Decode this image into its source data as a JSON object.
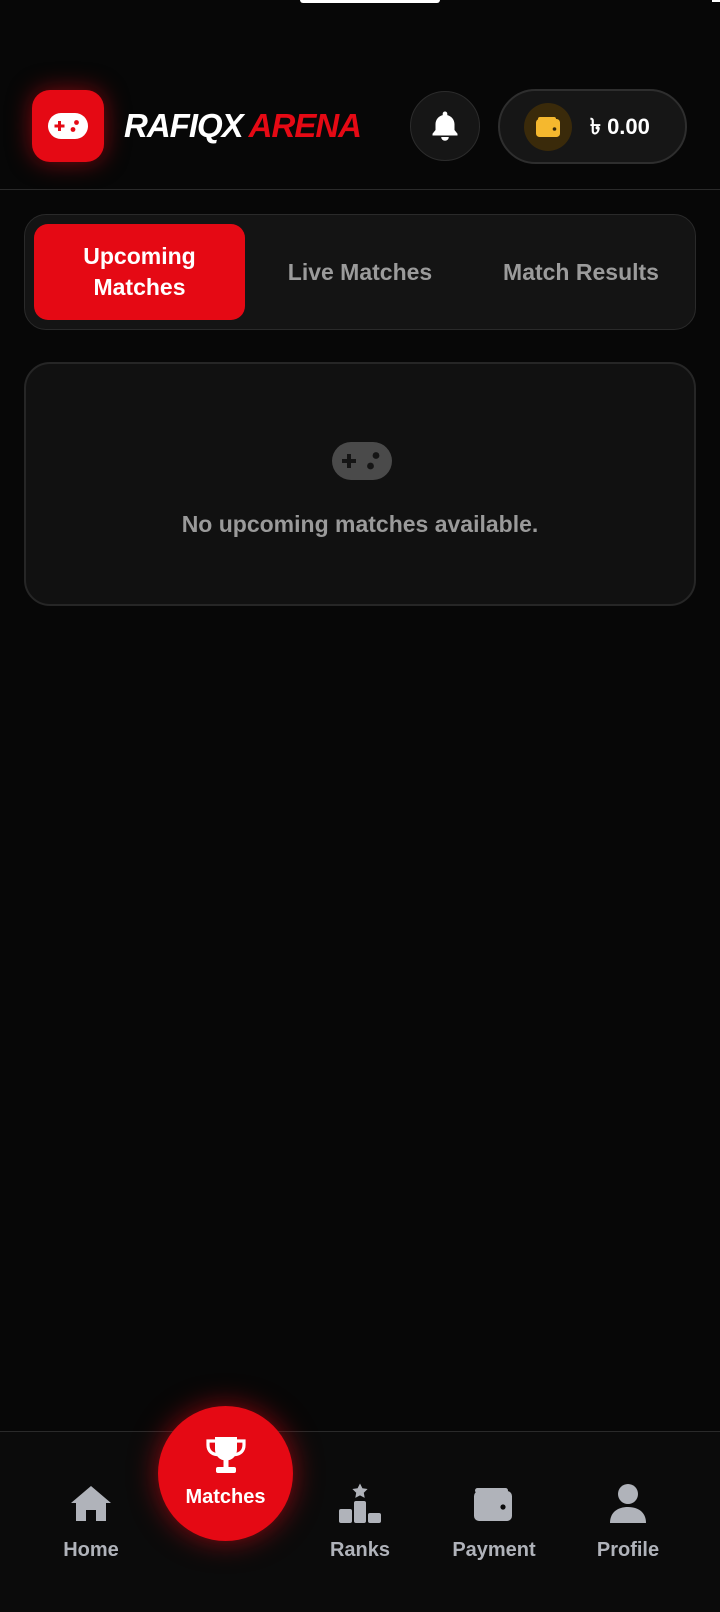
{
  "header": {
    "brand_part1": "RAFIQX",
    "brand_part2": "ARENA",
    "balance": "৳ 0.00",
    "icons": {
      "logo": "gamepad-icon",
      "notifications": "bell-icon",
      "wallet": "wallet-icon"
    }
  },
  "tabs": [
    {
      "label": "Upcoming Matches",
      "active": true
    },
    {
      "label": "Live Matches",
      "active": false
    },
    {
      "label": "Match Results",
      "active": false
    }
  ],
  "empty_state": {
    "icon": "gamepad-icon",
    "message": "No upcoming matches available."
  },
  "bottom_nav": [
    {
      "label": "Home",
      "icon": "home-icon",
      "active": false
    },
    {
      "label": "Matches",
      "icon": "trophy-icon",
      "active": true
    },
    {
      "label": "Ranks",
      "icon": "podium-icon",
      "active": false
    },
    {
      "label": "Payment",
      "icon": "wallet-icon",
      "active": false
    },
    {
      "label": "Profile",
      "icon": "user-icon",
      "active": false
    }
  ],
  "colors": {
    "accent": "#e50914",
    "background": "#070707",
    "surface": "#141414",
    "muted_text": "#9b9b9b",
    "wallet_gold": "#f5b82e"
  }
}
